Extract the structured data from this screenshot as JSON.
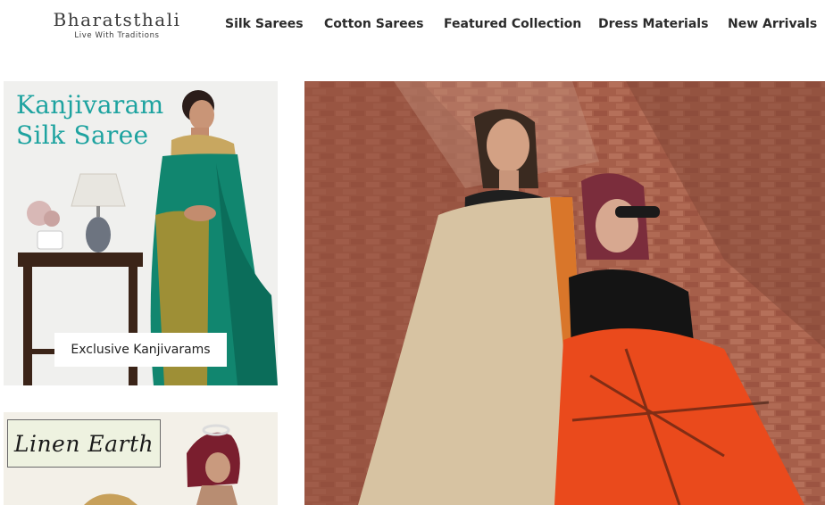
{
  "brand": {
    "name": "Bharatsthali",
    "tagline": "Live With Traditions"
  },
  "nav": {
    "items": [
      {
        "label": "Silk Sarees"
      },
      {
        "label": "Cotton Sarees"
      },
      {
        "label": "Featured Collection"
      },
      {
        "label": "Dress Materials"
      },
      {
        "label": "New Arrivals"
      }
    ]
  },
  "cards": {
    "kanjivaram": {
      "image_title_line1": "Kanjivaram",
      "image_title_line2": "Silk Saree",
      "label": "Exclusive Kanjivarams"
    },
    "linen": {
      "image_title": "Linen Earth"
    },
    "hero": {}
  }
}
